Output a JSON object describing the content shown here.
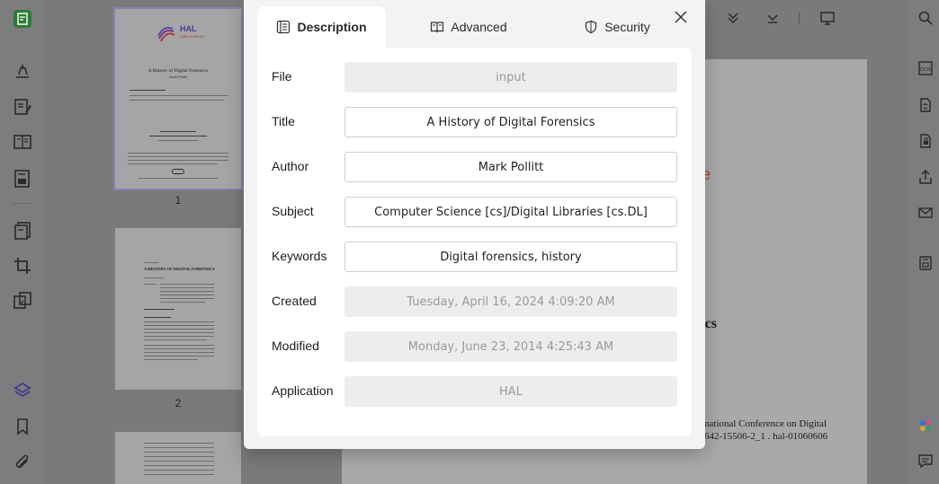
{
  "dialog": {
    "tabs": [
      {
        "label": "Description",
        "icon": "document-lines-icon",
        "active": true
      },
      {
        "label": "Advanced",
        "icon": "open-book-icon",
        "active": false
      },
      {
        "label": "Security",
        "icon": "shield-icon",
        "active": false
      }
    ],
    "fields": [
      {
        "label": "File",
        "value": "input",
        "editable": false
      },
      {
        "label": "Title",
        "value": "A History of Digital Forensics",
        "editable": true
      },
      {
        "label": "Author",
        "value": "Mark Pollitt",
        "editable": true
      },
      {
        "label": "Subject",
        "value": "Computer Science [cs]/Digital Libraries [cs.DL]",
        "editable": true
      },
      {
        "label": "Keywords",
        "value": "Digital forensics, history",
        "editable": true
      },
      {
        "label": "Created",
        "value": "Tuesday, April 16, 2024 4:09:20 AM",
        "editable": false
      },
      {
        "label": "Modified",
        "value": "Monday, June 23, 2014 4:25:43 AM",
        "editable": false
      },
      {
        "label": "Application",
        "value": "HAL",
        "editable": false
      }
    ]
  },
  "thumbnails": {
    "pages": [
      {
        "number": "1",
        "heading": "A History of Digital Forensics",
        "author": "Mark Pollitt",
        "logo": "HAL",
        "logo_sub": "open science",
        "selected": true
      },
      {
        "number": "2",
        "heading": "A HISTORY OF DIGITAL FORENSICS",
        "selected": false
      },
      {
        "number": "",
        "selected": false
      }
    ]
  },
  "document": {
    "fragments": {
      "red_fragment": "ce",
      "heading_fragment": "sics",
      "ref_line1": "national Conference on Digital",
      "ref_line2": "642-15506-2_1 .  hal-01060606"
    }
  },
  "colors": {
    "accent": "#4a9a3a",
    "dialog_bg": "#f3f3f3",
    "field_readonly": "#ededed",
    "doc_red": "#c0391b"
  }
}
